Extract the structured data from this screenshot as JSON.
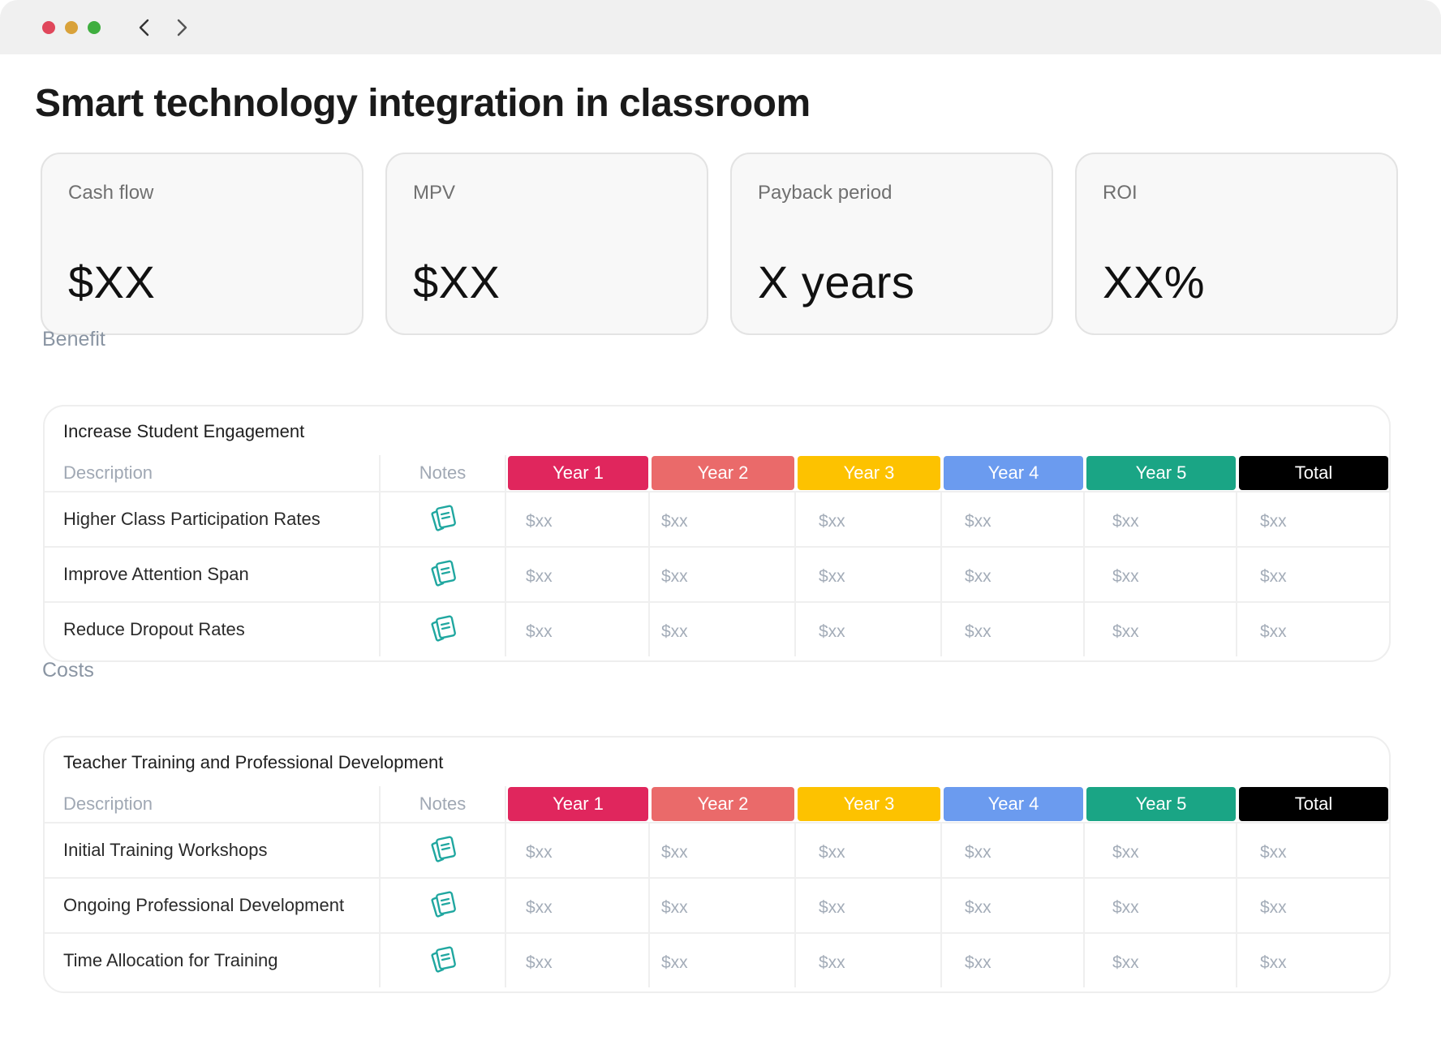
{
  "window": {
    "controls": [
      {
        "name": "close",
        "color": "#e0475b"
      },
      {
        "name": "minimize",
        "color": "#d9a23a"
      },
      {
        "name": "maximize",
        "color": "#3fae3f"
      }
    ],
    "nav": {
      "back_icon": "chevron-left-icon",
      "forward_icon": "chevron-right-icon"
    }
  },
  "page": {
    "title": "Smart technology integration in classroom"
  },
  "kpis": [
    {
      "label": "Cash flow",
      "value": "$XX"
    },
    {
      "label": "MPV",
      "value": "$XX"
    },
    {
      "label": "Payback period",
      "value": "X years"
    },
    {
      "label": "ROI",
      "value": "XX%"
    }
  ],
  "columns": {
    "description": "Description",
    "notes": "Notes",
    "years": [
      {
        "label": "Year 1",
        "color": "#e0265d"
      },
      {
        "label": "Year 2",
        "color": "#ea6a6a"
      },
      {
        "label": "Year 3",
        "color": "#fdc200"
      },
      {
        "label": "Year 4",
        "color": "#6b9bef"
      },
      {
        "label": "Year 5",
        "color": "#1aa585"
      }
    ],
    "total": {
      "label": "Total",
      "color": "#000000"
    }
  },
  "sections": [
    {
      "label": "Benefit",
      "group_title": "Increase Student Engagement",
      "rows": [
        {
          "description": "Higher Class Participation Rates",
          "values": [
            "$xx",
            "$xx",
            "$xx",
            "$xx",
            "$xx",
            "$xx"
          ]
        },
        {
          "description": "Improve Attention Span",
          "values": [
            "$xx",
            "$xx",
            "$xx",
            "$xx",
            "$xx",
            "$xx"
          ]
        },
        {
          "description": "Reduce Dropout Rates",
          "values": [
            "$xx",
            "$xx",
            "$xx",
            "$xx",
            "$xx",
            "$xx"
          ]
        }
      ]
    },
    {
      "label": "Costs",
      "group_title": "Teacher Training and Professional Development",
      "rows": [
        {
          "description": "Initial Training Workshops",
          "values": [
            "$xx",
            "$xx",
            "$xx",
            "$xx",
            "$xx",
            "$xx"
          ]
        },
        {
          "description": "Ongoing Professional Development",
          "values": [
            "$xx",
            "$xx",
            "$xx",
            "$xx",
            "$xx",
            "$xx"
          ]
        },
        {
          "description": "Time Allocation for Training",
          "values": [
            "$xx",
            "$xx",
            "$xx",
            "$xx",
            "$xx",
            "$xx"
          ]
        }
      ]
    }
  ],
  "icons": {
    "notes": "notes-icon",
    "notes_color": "#20a7a0"
  }
}
